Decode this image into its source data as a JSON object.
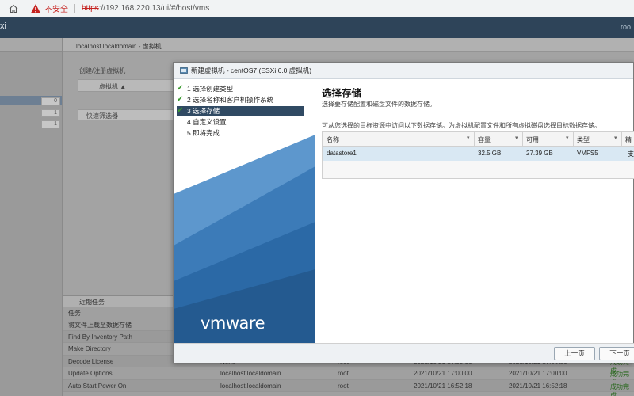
{
  "browser": {
    "insecure_label": "不安全",
    "url_scheme": "https",
    "url_rest": "://192.168.220.13/ui/#/host/vms"
  },
  "esxi": {
    "brand": "xi",
    "user": "roo"
  },
  "background": {
    "left_counts": [
      "0",
      "1",
      "1"
    ],
    "panel_title": "localhost.localdomain - 虚拟机",
    "toolbar_create": "创建/注册虚拟机",
    "grid_col_vm": "虚拟机 ▲",
    "filter_placeholder": "快速筛选器",
    "tasks_title": "近期任务",
    "tasks_col_task": "任务",
    "tasks_rows": [
      {
        "task": "将文件上载至数据存储",
        "target": "",
        "initiator": "",
        "queued": "",
        "started": "",
        "result": ""
      },
      {
        "task": "Find By Inventory Path",
        "target": "",
        "initiator": "",
        "queued": "",
        "started": "",
        "result": ""
      },
      {
        "task": "Make Directory",
        "target": "",
        "initiator": "",
        "queued": "",
        "started": "",
        "result": ""
      },
      {
        "task": "Decode License",
        "target": "None",
        "initiator": "root",
        "queued": "2021/10/21 17:00:06",
        "started": "2021/10/21 17:00:06",
        "result": "成功完成"
      },
      {
        "task": "Update Options",
        "target": "localhost.localdomain",
        "initiator": "root",
        "queued": "2021/10/21 17:00:00",
        "started": "2021/10/21 17:00:00",
        "result": "成功完成"
      },
      {
        "task": "Auto Start Power On",
        "target": "localhost.localdomain",
        "initiator": "root",
        "queued": "2021/10/21 16:52:18",
        "started": "2021/10/21 16:52:18",
        "result": "成功完成"
      }
    ]
  },
  "wizard": {
    "title": "新建虚拟机 - centOS7 (ESXi 6.0 虚拟机)",
    "steps": [
      {
        "label": "1 选择创建类型",
        "done": true
      },
      {
        "label": "2 选择名称和客户机操作系统",
        "done": true
      },
      {
        "label": "3 选择存储",
        "done": true,
        "active": true
      },
      {
        "label": "4 自定义设置",
        "done": false
      },
      {
        "label": "5 即将完成",
        "done": false
      }
    ],
    "logo_text": "vmware",
    "heading": "选择存储",
    "subheading": "选择要存储配置和磁盘文件的数据存储。",
    "description": "可从您选择的目标资源中访问以下数据存储。为虚拟机配置文件和所有虚拟磁盘选择目标数据存储。",
    "columns": [
      "名称",
      "容量",
      "可用",
      "类型",
      "精"
    ],
    "datastores": [
      {
        "name": "datastore1",
        "capacity": "32.5 GB",
        "free": "27.39 GB",
        "type": "VMFS5",
        "extra": "支"
      }
    ],
    "back_button": "上一页",
    "next_button": "下一页"
  }
}
